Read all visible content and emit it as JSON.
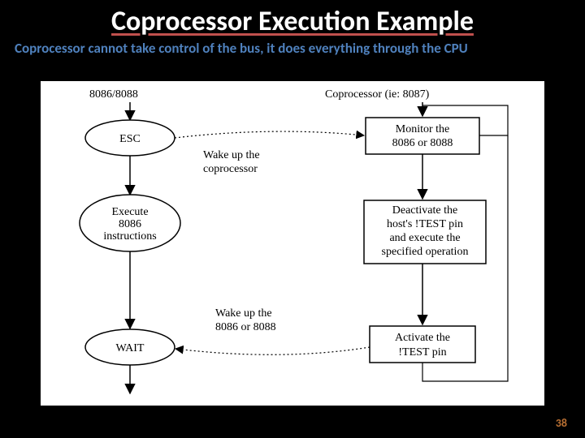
{
  "title": "Coprocessor Execution Example",
  "subtitle": "Coprocessor cannot take control of the bus, it does everything through the CPU",
  "left_header": "8086/8088",
  "right_header": "Coprocessor (ie: 8087)",
  "nodes": {
    "esc": "ESC",
    "exec_l1": "Execute",
    "exec_l2": "8086",
    "exec_l3": "instructions",
    "wait": "WAIT",
    "mon_l1": "Monitor the",
    "mon_l2": "8086 or 8088",
    "deact_l1": "Deactivate the",
    "deact_l2": "host's !TEST pin",
    "deact_l3": "and execute the",
    "deact_l4": "specified operation",
    "act_l1": "Activate the",
    "act_l2": "!TEST pin"
  },
  "labels": {
    "wake_coproc_l1": "Wake up the",
    "wake_coproc_l2": "coprocessor",
    "wake_cpu_l1": "Wake up the",
    "wake_cpu_l2": "8086 or 8088"
  },
  "pagenum": "38"
}
